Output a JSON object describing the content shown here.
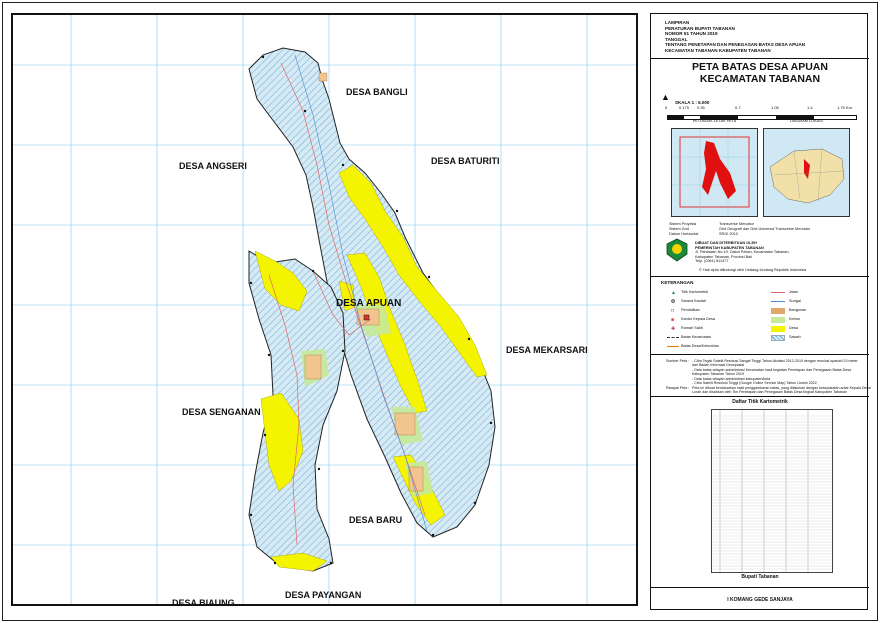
{
  "map": {
    "villages": {
      "bangli": "DESA BANGLI",
      "angseri": "DESA ANGSERI",
      "baturiti": "DESA BATURITI",
      "apuan": "DESA APUAN",
      "mekarsari": "DESA MEKARSARI",
      "senganan": "DESA SENGANAN",
      "baru": "DESA BARU",
      "biaung": "DESA BIAUNG",
      "payangan": "DESA PAYANGAN"
    },
    "colors": {
      "settlement": "#f4f400",
      "field": "#cfe6ef",
      "hatch": "#5aa0d8",
      "road": "#e06a6a",
      "boundary": "#222222"
    }
  },
  "sidebar": {
    "header": {
      "l1": "LAMPIRAN",
      "l2": "PERATURAN BUPATI TABANAN",
      "l3": "NOMOR 51 TAHUN 2019",
      "l4": "TANGGAL",
      "l5": "TENTANG PENETAPAN DAN PENEGASAN BATAS DESA APUAN",
      "l6": "KECAMATAN TABANAN KABUPATEN TABANAN"
    },
    "title1": "PETA BATAS DESA APUAN",
    "title2": "KECAMATAN TABANAN",
    "scale": {
      "label": "SKALA 1 : 6.000",
      "ticks": [
        "0",
        "0.175",
        "0.35",
        "0.7",
        "1.05",
        "1.4",
        "1.75 Km"
      ]
    },
    "insets": {
      "left": "PETUNJUK LETAK PETA",
      "right": "DIAGRAM LOKASI"
    },
    "meta": [
      {
        "k": "Sistem Proyeksi",
        "v": "Transverse Mercator"
      },
      {
        "k": "Sistem Grid",
        "v": "Grid Geografi dan Grid Universal Transverse Mercator"
      },
      {
        "k": "Datum Horizontal",
        "v": "SRGI 2013"
      }
    ],
    "agency": {
      "l1": "DIBUAT DAN DITERBITKAN OLEH",
      "l2": "PEMERINTAH KABUPATEN TABANAN",
      "l3": "Jl. Pahlawan No.19, Dalod Pekan, Kecamatan Tabanan,",
      "l4": "Kabupaten Tabanan, Provinsi Bali",
      "l5": "Telp. (0361) 811477"
    },
    "copyright": "© Hak cipta dilindungi oleh Undang-Undang Republik Indonesia",
    "legend_title": "KETERANGAN",
    "legend_left": [
      "Titik Kartometrik",
      "Sarana Ibadah",
      "Pendidikan",
      "Kantor Kepala Desa",
      "Rumah Sakit",
      "Batas Kecamatan",
      "Batas Desa/Kelurahan"
    ],
    "legend_right": [
      "Jalan",
      "Sungai",
      "Bangunan",
      "Kebun",
      "Desa",
      "Sawah"
    ],
    "sumber_label": "Sumber Peta :",
    "sumber": [
      "- Citra Tegak Satelit Resolusi Sangat Tinggi Tahun Akuisisi 2013-2019 dengan resolusi spasial 0,5 meter",
      "  dari Badan Informasi Geospasial",
      "- Data batas wilayah administrasi Kecamatan hasil kegiatan Penetapan dan Penegasan Batas Desa",
      "  Kabupaten Tabanan Tahun 2019",
      "- Data batas wilayah administrasi kabupaten/kota",
      "- Citra Satelit Resolusi Tinggi (Google Online Service Map) Tahun Unduh 2022"
    ],
    "riwayat_label": "Riwayat Peta :",
    "riwayat": [
      "Peta ini dibuat berdasarkan hasil penggambaran batas, yang dilakukan dengan kesepakatan antar Kepala Desa/",
      "Lurah dan disahkan oleh Tim Penetapan dan Penegasan Batas Desa tingkat Kabupaten Tabanan"
    ],
    "table_title": "Daftar Titik Kartometrik",
    "bupati": "Bupati Tabanan",
    "signer": "I KOMANG GEDE SANJAYA"
  }
}
